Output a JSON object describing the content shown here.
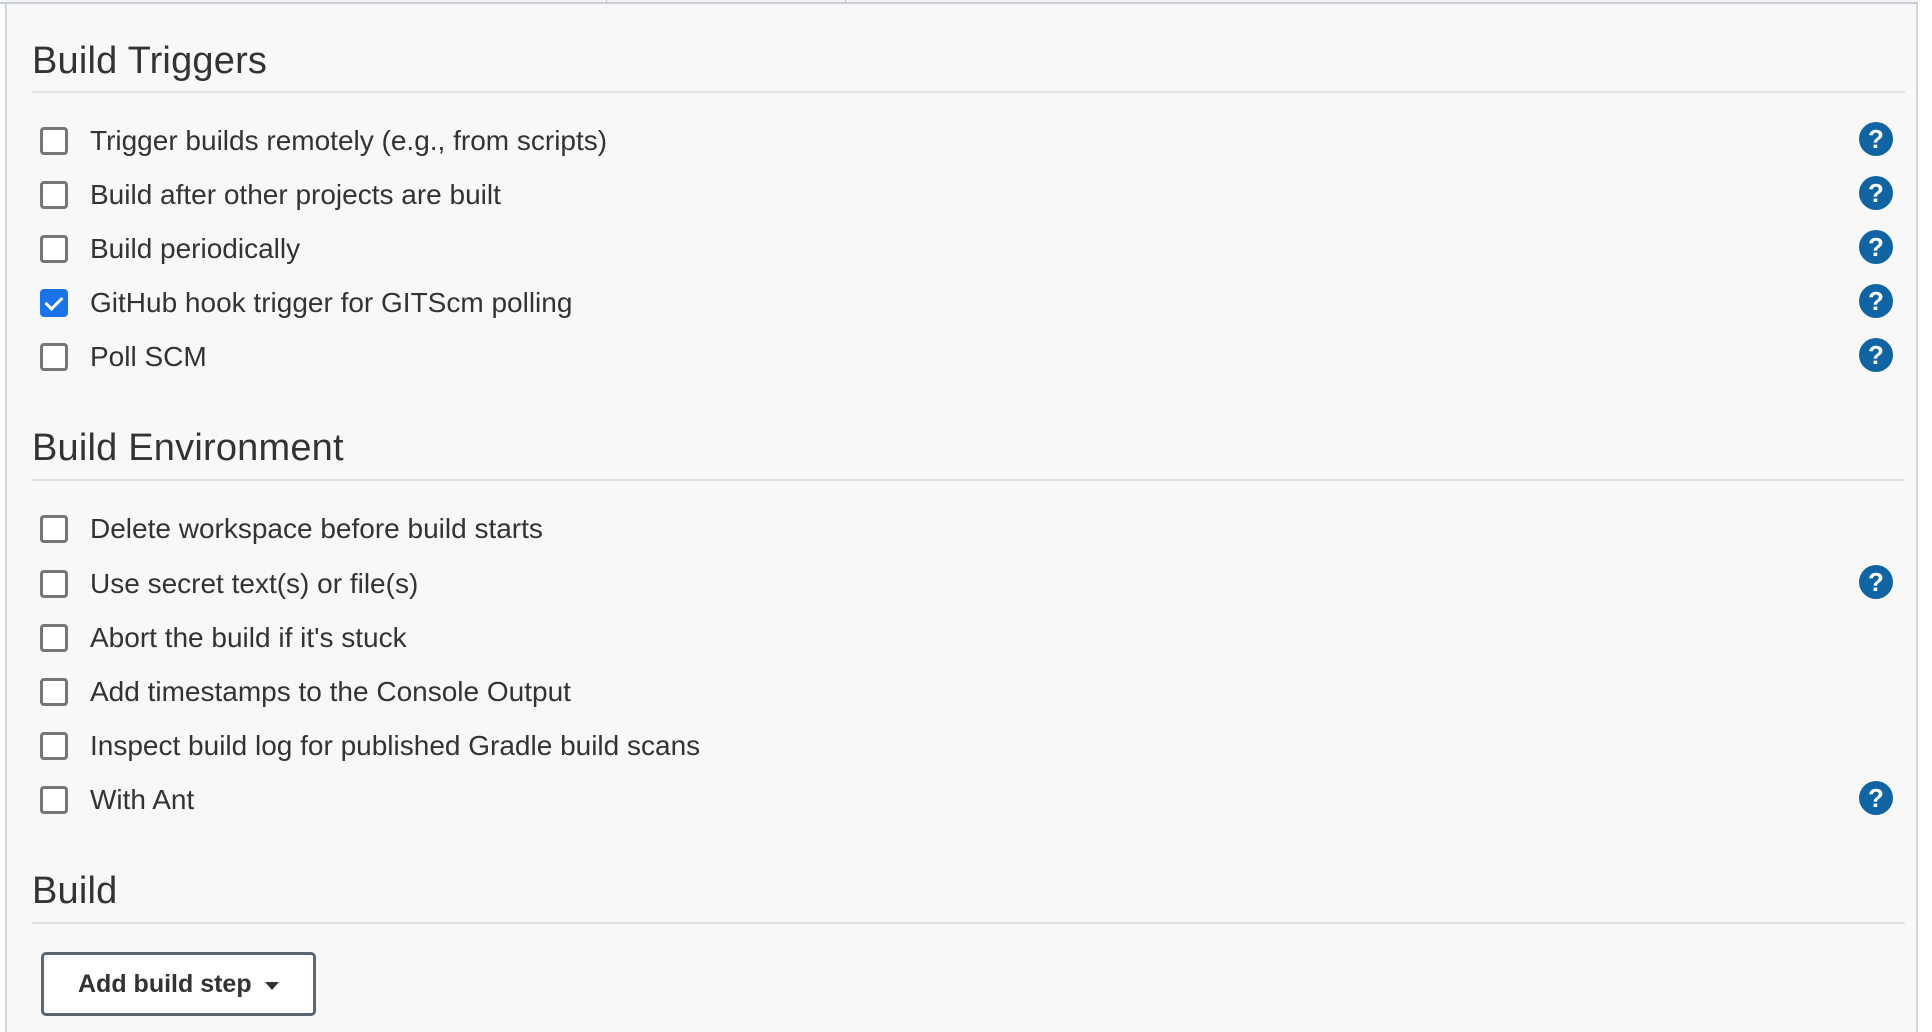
{
  "sections": {
    "build_triggers": {
      "title": "Build Triggers",
      "options": [
        {
          "label": "Trigger builds remotely (e.g., from scripts)",
          "checked": false,
          "help": true
        },
        {
          "label": "Build after other projects are built",
          "checked": false,
          "help": true
        },
        {
          "label": "Build periodically",
          "checked": false,
          "help": true
        },
        {
          "label": "GitHub hook trigger for GITScm polling",
          "checked": true,
          "help": true
        },
        {
          "label": "Poll SCM",
          "checked": false,
          "help": true
        }
      ]
    },
    "build_environment": {
      "title": "Build Environment",
      "options": [
        {
          "label": "Delete workspace before build starts",
          "checked": false,
          "help": false
        },
        {
          "label": "Use secret text(s) or file(s)",
          "checked": false,
          "help": true
        },
        {
          "label": "Abort the build if it's stuck",
          "checked": false,
          "help": false
        },
        {
          "label": "Add timestamps to the Console Output",
          "checked": false,
          "help": false
        },
        {
          "label": "Inspect build log for published Gradle build scans",
          "checked": false,
          "help": false
        },
        {
          "label": "With Ant",
          "checked": false,
          "help": true
        }
      ]
    },
    "build": {
      "title": "Build",
      "add_step_label": "Add build step"
    }
  },
  "help_icon_glyph": "?",
  "icons": {
    "help": "question-circle-icon",
    "dropdown": "caret-down-icon",
    "check": "checkmark-icon"
  },
  "colors": {
    "accent": "#1a73e8",
    "help": "#1064a3",
    "text": "#333333",
    "panel_bg": "#f8f8f8",
    "divider": "#e0e3e6"
  }
}
